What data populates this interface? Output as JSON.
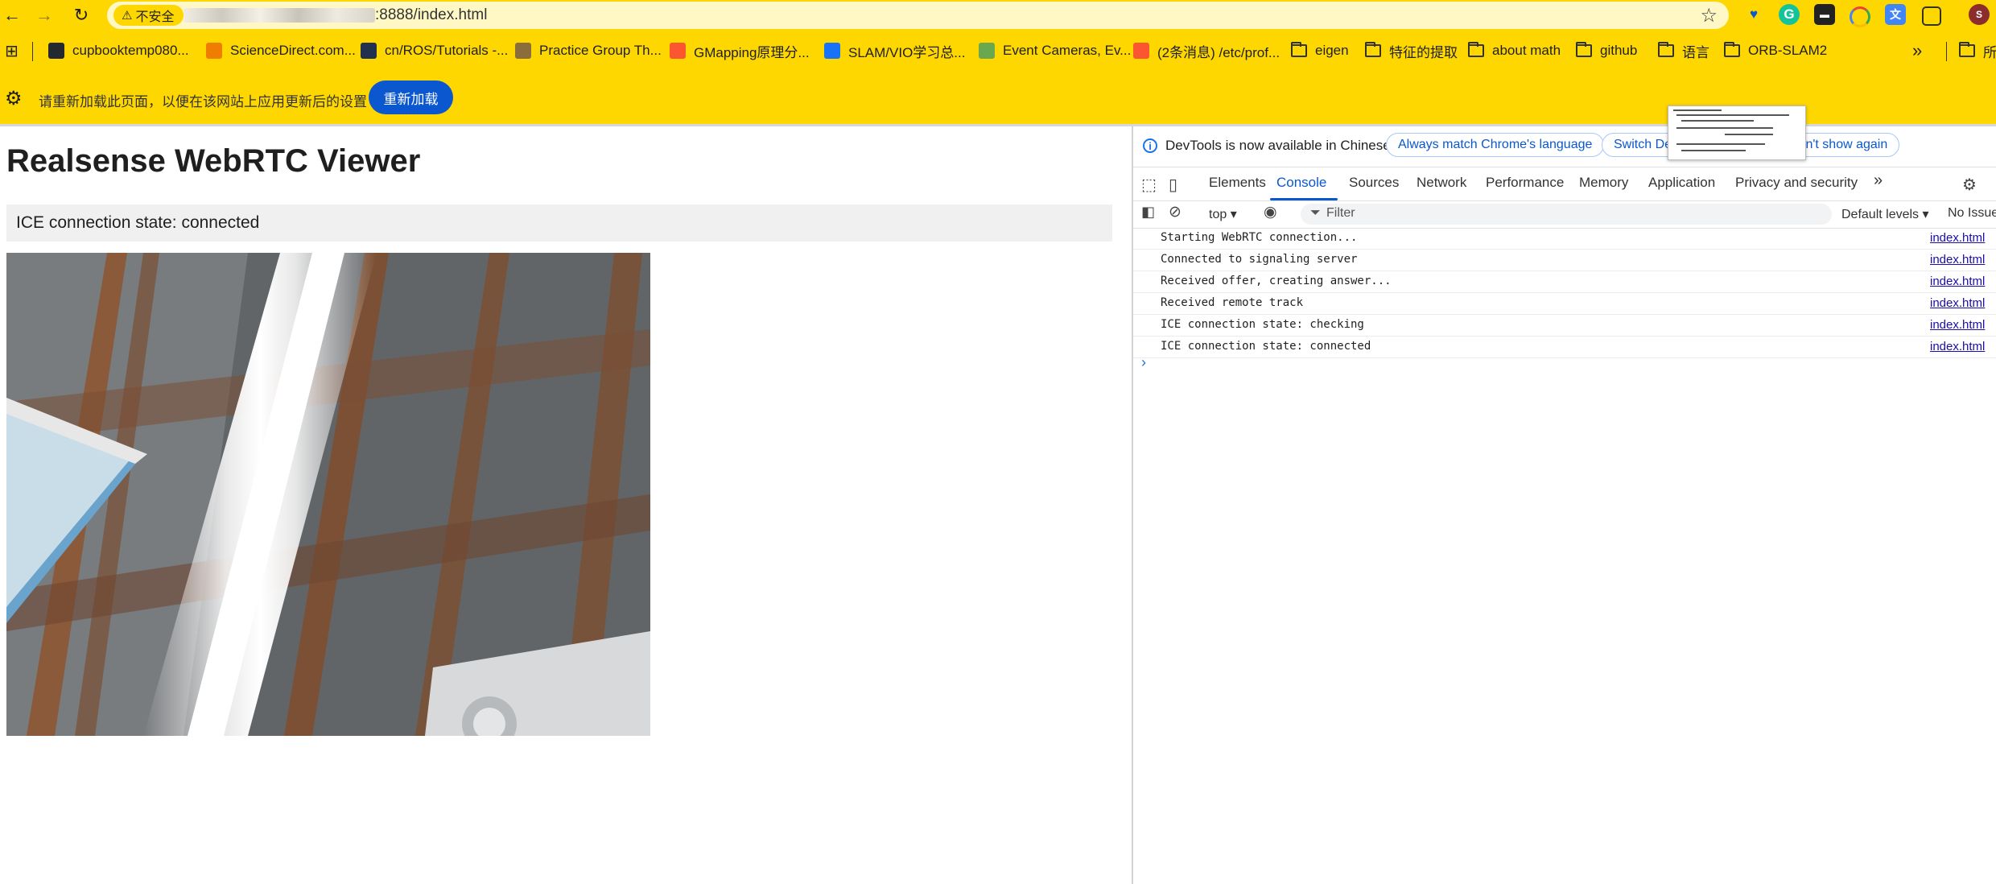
{
  "browser": {
    "security_label": "不安全",
    "url_suffix": ":8888/index.html",
    "bookmarks": [
      {
        "label": "cupbooktemp080...",
        "icon": "github-icon",
        "color": "#24292f"
      },
      {
        "label": "ScienceDirect.com...",
        "icon": "elsevier-icon",
        "color": "#f07c00"
      },
      {
        "label": "cn/ROS/Tutorials -...",
        "icon": "ros-icon",
        "color": "#22314e"
      },
      {
        "label": "Practice Group Th...",
        "icon": "practice-group-icon",
        "color": "#8a6d3b"
      },
      {
        "label": "GMapping原理分...",
        "icon": "csdn-icon",
        "color": "#fc5531"
      },
      {
        "label": "SLAM/VIO学习总...",
        "icon": "zhihu-icon",
        "color": "#1772f6"
      },
      {
        "label": "Event Cameras, Ev...",
        "icon": "event-cameras-icon",
        "color": "#6aa84f"
      },
      {
        "label": "(2条消息) /etc/prof...",
        "icon": "csdn-icon",
        "color": "#fc5531"
      },
      {
        "label": "eigen",
        "icon": "folder-icon"
      },
      {
        "label": "特征的提取",
        "icon": "folder-icon"
      },
      {
        "label": "about math",
        "icon": "folder-icon"
      },
      {
        "label": "github",
        "icon": "folder-icon"
      },
      {
        "label": "语言",
        "icon": "folder-icon"
      },
      {
        "label": "ORB-SLAM2",
        "icon": "folder-icon"
      }
    ],
    "bookmarks_overflow": "»",
    "bookmarks_other": "所"
  },
  "infobar": {
    "message": "请重新加载此页面，以便在该网站上应用更新后的设置",
    "reload_label": "重新加载"
  },
  "page": {
    "title": "Realsense WebRTC Viewer",
    "status": "ICE connection state: connected"
  },
  "devtools": {
    "notice": "DevTools is now available in Chinese!",
    "btn_match": "Always match Chrome's language",
    "btn_switch": "Switch De",
    "btn_dont_show": "Don't show again",
    "tabs": [
      "Elements",
      "Console",
      "Sources",
      "Network",
      "Performance",
      "Memory",
      "Application",
      "Privacy and security"
    ],
    "more_tabs": "»",
    "context": "top ▾",
    "filter_placeholder": "Filter",
    "levels": "Default levels ▾",
    "issues": "No Issue",
    "logs": [
      {
        "msg": "Starting WebRTC connection...",
        "src": "index.html"
      },
      {
        "msg": "Connected to signaling server",
        "src": "index.html"
      },
      {
        "msg": "Received offer, creating answer...",
        "src": "index.html"
      },
      {
        "msg": "Received remote track",
        "src": "index.html"
      },
      {
        "msg": "ICE connection state: checking",
        "src": "index.html"
      },
      {
        "msg": "ICE connection state: connected",
        "src": "index.html"
      }
    ],
    "prompt": "›"
  },
  "colors": {
    "theme_yellow": "#fed700",
    "accent_blue": "#0b57d0"
  }
}
